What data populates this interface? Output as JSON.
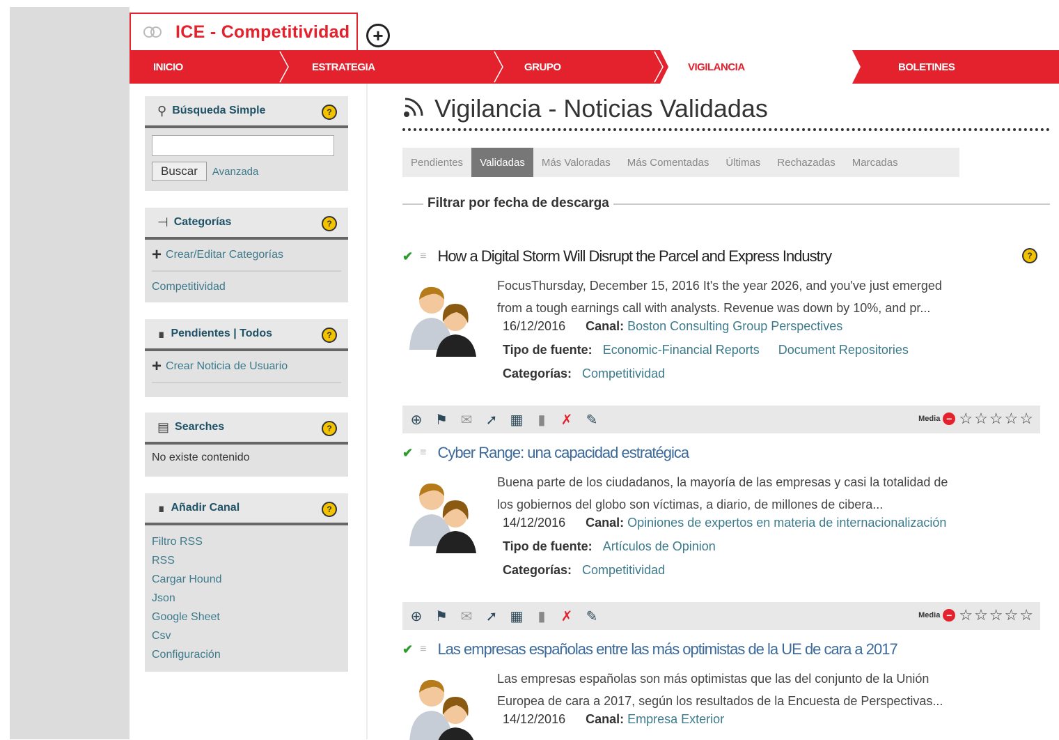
{
  "app": {
    "tab_title": "ICE - Competitividad",
    "add_tab": "+"
  },
  "nav": {
    "items": [
      "INICIO",
      "ESTRATEGIA",
      "GRUPO",
      "VIGILANCIA",
      "BOLETINES"
    ],
    "active": "VIGILANCIA"
  },
  "sidebar": {
    "search": {
      "title": "Búsqueda Simple",
      "input_value": "",
      "button": "Buscar",
      "advanced": "Avanzada"
    },
    "categories": {
      "title": "Categorías",
      "action": "Crear/Editar Categorías",
      "items": [
        "Competitividad"
      ]
    },
    "pending": {
      "title": "Pendientes | Todos",
      "action": "Crear Noticia de Usuario"
    },
    "searches": {
      "title": "Searches",
      "empty": "No existe contenido"
    },
    "add_channel": {
      "title": "Añadir Canal",
      "items": [
        "Filtro RSS",
        "RSS",
        "Cargar Hound",
        "Json",
        "Google Sheet",
        "Csv",
        "Configuración"
      ]
    },
    "help": "?"
  },
  "main": {
    "title": "Vigilancia - Noticias Validadas",
    "tabs": [
      "Pendientes",
      "Validadas",
      "Más Valoradas",
      "Más Comentadas",
      "Últimas",
      "Rechazadas",
      "Marcadas"
    ],
    "active_tab": "Validadas",
    "filter_label": "Filtrar por fecha de descarga",
    "labels": {
      "channel": "Canal:",
      "source_type": "Tipo de fuente:",
      "categories": "Categorías:",
      "rating": "Media"
    },
    "news": [
      {
        "title": "How a Digital Storm Will Disrupt the Parcel and Express Industry",
        "summary_1": "FocusThursday, December 15, 2016 It's the year 2026, and you've just emerged",
        "summary_2": "from a tough earnings call with analysts. Revenue was down by 10%, and pr...",
        "date": "16/12/2016",
        "channel": "Boston Consulting Group Perspectives",
        "source_types": [
          "Economic-Financial Reports",
          "Document Repositories"
        ],
        "category": "Competitividad"
      },
      {
        "title": "Cyber Range: una capacidad estratégica",
        "summary_1": "Buena parte de los ciudadanos, la mayoría de las empresas y casi la totalidad de",
        "summary_2": "los gobiernos del globo son víctimas, a diario, de millones de cibera...",
        "date": "14/12/2016",
        "channel": "Opiniones de expertos en materia de internacionalización",
        "source_types": [
          "Artículos de Opinion"
        ],
        "category": "Competitividad"
      },
      {
        "title": "Las empresas españolas entre las más optimistas de la UE de cara a 2017",
        "summary_1": "Las empresas españolas son más optimistas que las del conjunto de la Unión",
        "summary_2": "Europea de cara a 2017, según los resultados de la Encuesta de Perspectivas...",
        "date": "14/12/2016",
        "channel": "Empresa Exterior"
      }
    ],
    "rating": {
      "stars": 5,
      "value": 0
    }
  },
  "colors": {
    "brand_red": "#e4222d",
    "link": "#3c7a8c",
    "sidebar_title": "#1e5266"
  }
}
